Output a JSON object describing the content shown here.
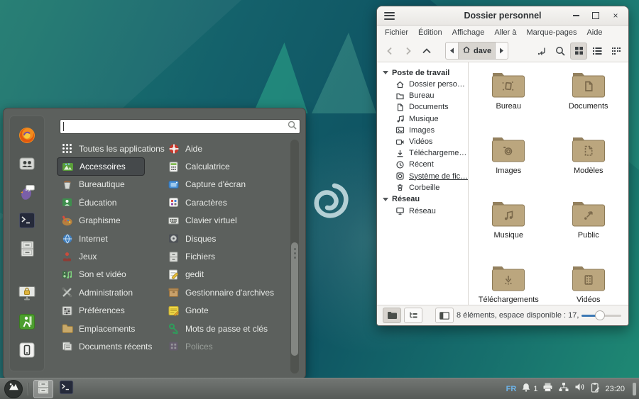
{
  "menu": {
    "search": {
      "placeholder": "",
      "value": ""
    },
    "categories": [
      {
        "label": "Toutes les applications",
        "icon": "all-applications"
      },
      {
        "label": "Accessoires",
        "icon": "accessories",
        "selected": true
      },
      {
        "label": "Bureautique",
        "icon": "office"
      },
      {
        "label": "Éducation",
        "icon": "education"
      },
      {
        "label": "Graphisme",
        "icon": "graphics"
      },
      {
        "label": "Internet",
        "icon": "internet"
      },
      {
        "label": "Jeux",
        "icon": "games"
      },
      {
        "label": "Son et vidéo",
        "icon": "sound-video"
      },
      {
        "label": "Administration",
        "icon": "administration"
      },
      {
        "label": "Préférences",
        "icon": "preferences"
      },
      {
        "label": "Emplacements",
        "icon": "places"
      },
      {
        "label": "Documents récents",
        "icon": "recent-documents"
      }
    ],
    "apps": [
      {
        "label": "Aide",
        "icon": "help"
      },
      {
        "label": "Calculatrice",
        "icon": "calculator"
      },
      {
        "label": "Capture d'écran",
        "icon": "screenshot"
      },
      {
        "label": "Caractères",
        "icon": "characters"
      },
      {
        "label": "Clavier virtuel",
        "icon": "virtual-keyboard"
      },
      {
        "label": "Disques",
        "icon": "disks"
      },
      {
        "label": "Fichiers",
        "icon": "files"
      },
      {
        "label": "gedit",
        "icon": "gedit"
      },
      {
        "label": "Gestionnaire d'archives",
        "icon": "archive-manager"
      },
      {
        "label": "Gnote",
        "icon": "gnote"
      },
      {
        "label": "Mots de passe et clés",
        "icon": "passwords-keys"
      },
      {
        "label": "Polices",
        "icon": "fonts",
        "disabled": true
      }
    ],
    "favorites": [
      "firefox",
      "users",
      "pidgin",
      "terminal",
      "file-manager"
    ],
    "session": [
      "lock-screen",
      "log-out",
      "suspend"
    ]
  },
  "window": {
    "title": "Dossier personnel",
    "menubar": [
      "Fichier",
      "Édition",
      "Affichage",
      "Aller à",
      "Marque-pages",
      "Aide"
    ],
    "toolbar": {
      "breadcrumb": "dave"
    },
    "sidebar": {
      "section1": {
        "label": "Poste de travail"
      },
      "items1": [
        {
          "label": "Dossier perso…",
          "icon": "home"
        },
        {
          "label": "Bureau",
          "icon": "folder"
        },
        {
          "label": "Documents",
          "icon": "document"
        },
        {
          "label": "Musique",
          "icon": "music"
        },
        {
          "label": "Images",
          "icon": "image"
        },
        {
          "label": "Vidéos",
          "icon": "video"
        },
        {
          "label": "Téléchargeme…",
          "icon": "download"
        },
        {
          "label": "Récent",
          "icon": "recent"
        },
        {
          "label": "Système de fic…",
          "icon": "filesystem"
        },
        {
          "label": "Corbeille",
          "icon": "trash"
        }
      ],
      "section2": {
        "label": "Réseau"
      },
      "items2": [
        {
          "label": "Réseau",
          "icon": "network"
        }
      ]
    },
    "files": [
      {
        "label": "Bureau",
        "emblem": "desktop"
      },
      {
        "label": "Documents",
        "emblem": "document"
      },
      {
        "label": "Images",
        "emblem": "camera"
      },
      {
        "label": "Modèles",
        "emblem": "template"
      },
      {
        "label": "Musique",
        "emblem": "music"
      },
      {
        "label": "Public",
        "emblem": "share"
      },
      {
        "label": "Téléchargements",
        "emblem": "download"
      },
      {
        "label": "Vidéos",
        "emblem": "film"
      }
    ],
    "statusbar": {
      "text": "8 éléments, espace disponible : 17,…"
    }
  },
  "taskbar": {
    "layout_indicator": "FR",
    "notification_count": "1",
    "clock": "23:20"
  }
}
